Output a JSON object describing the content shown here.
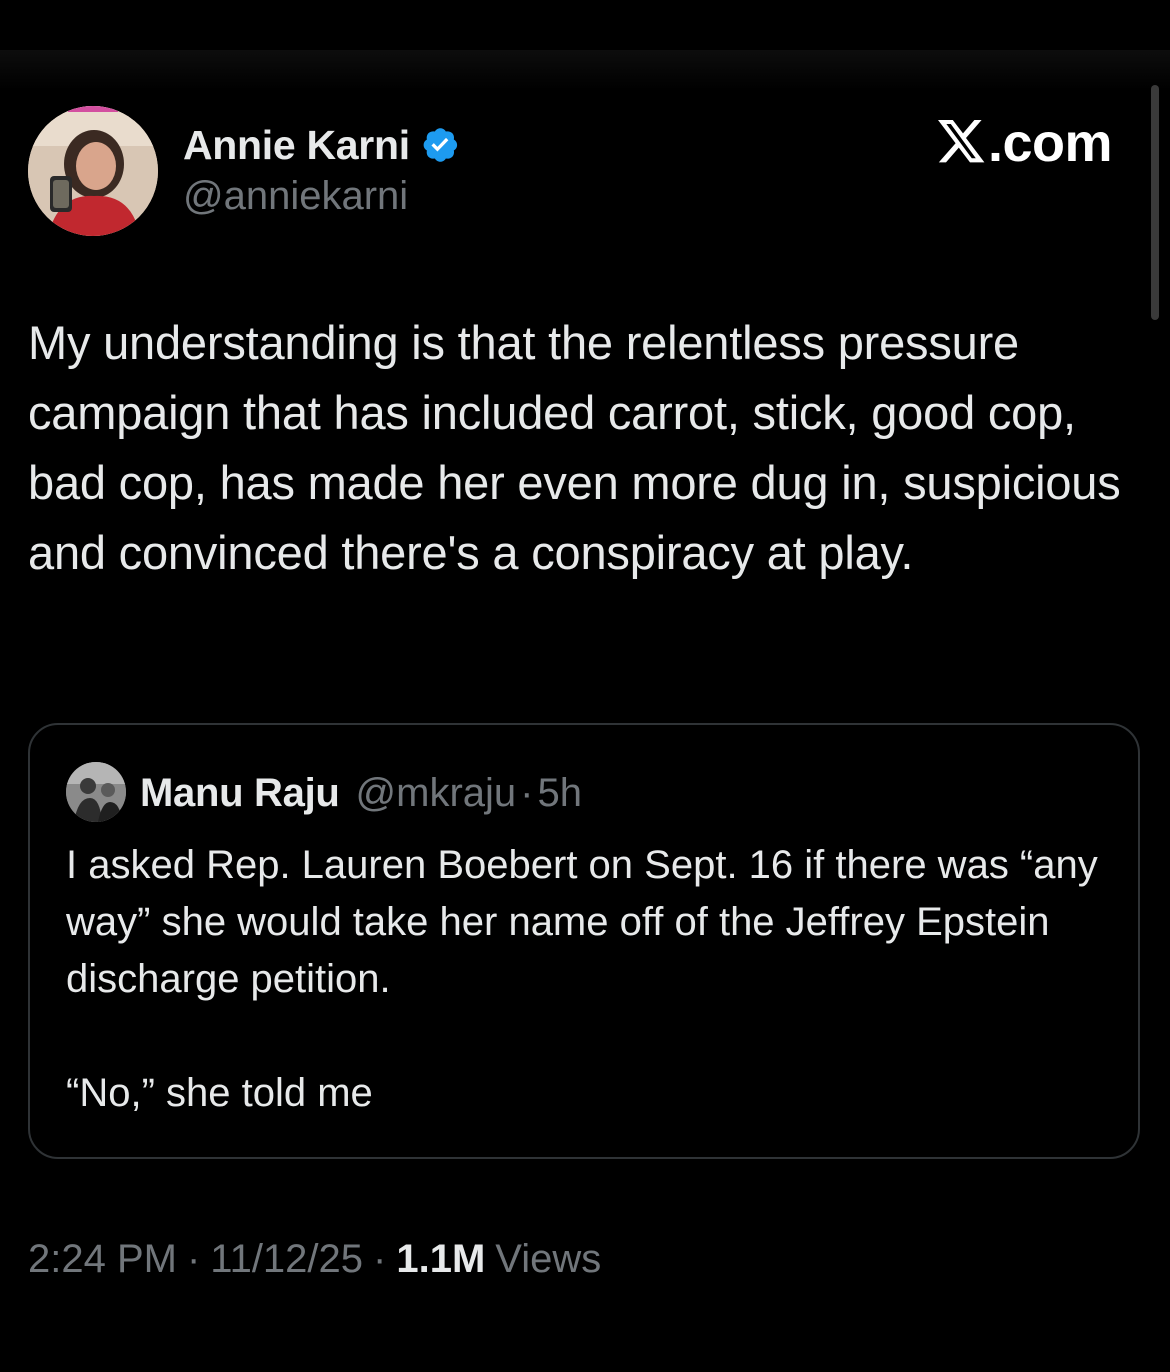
{
  "brand": {
    "text": ".com",
    "logo_icon": "x-logo-icon"
  },
  "author": {
    "display_name": "Annie Karni",
    "handle": "@anniekarni",
    "verified": true,
    "verified_color": "#1d9bf0",
    "avatar_icon": "profile-photo"
  },
  "tweet": {
    "text": "My understanding is that the relentless pressure campaign that has included carrot, stick, good cop, bad cop, has made her even more dug in, suspicious and convinced there's a conspiracy at play."
  },
  "quoted_tweet": {
    "display_name": "Manu Raju",
    "handle": "@mkraju",
    "separator": "·",
    "time": "5h",
    "text": "I asked Rep. Lauren Boebert on Sept. 16 if there was “any way” she would take her name off of the Jeffrey Epstein discharge petition.\n\n“No,” she told me"
  },
  "meta": {
    "time": "2:24 PM",
    "separator": "·",
    "date": "11/12/25",
    "views_count": "1.1M",
    "views_label": "Views"
  },
  "colors": {
    "background": "#000000",
    "text_primary": "#e7e9ea",
    "text_secondary": "#71767b",
    "border": "#2f3336"
  }
}
